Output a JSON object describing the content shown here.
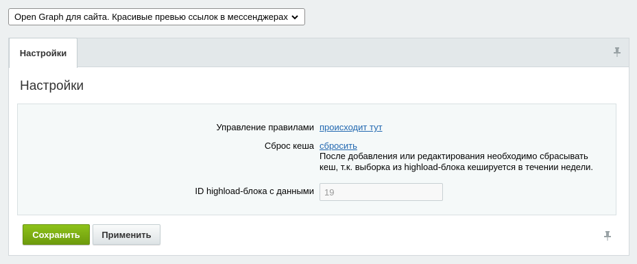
{
  "module_select": {
    "selected": "Open Graph для сайта. Красивые превью ссылок в мессенджерах.",
    "icon": "chevron-down-icon"
  },
  "tabs": [
    {
      "label": "Настройки"
    }
  ],
  "panel": {
    "title": "Настройки",
    "rows": {
      "rules": {
        "label": "Управление правилами",
        "link": "происходит тут"
      },
      "cache": {
        "label": "Сброс кеша",
        "link": "сбросить",
        "hint": "После добавления или редактирования необходимо сбрасывать кеш, т.к. выборка из highload-блока кешируется в течении недели."
      },
      "hlblock": {
        "label": "ID highload-блока с данными",
        "value": "19"
      }
    }
  },
  "buttons": {
    "save": "Сохранить",
    "apply": "Применить"
  },
  "icons": {
    "pin": "pin-icon"
  },
  "colors": {
    "save_green": "#7fb414",
    "link_blue": "#2067b0",
    "settings_bg": "#f5f9f9",
    "page_bg": "#edf0f1"
  }
}
